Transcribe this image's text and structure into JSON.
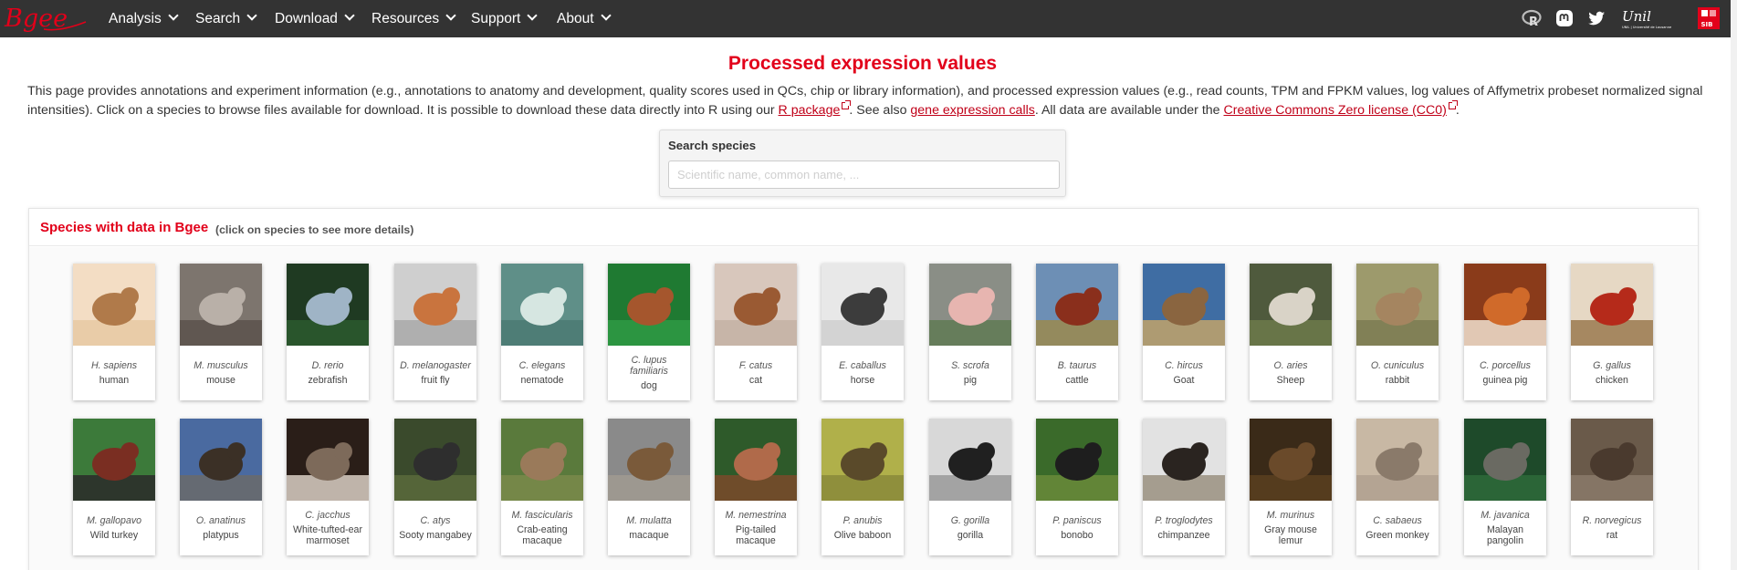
{
  "nav": {
    "logo_text": "Bgee",
    "items": [
      {
        "label": "Analysis"
      },
      {
        "label": "Search"
      },
      {
        "label": "Download"
      },
      {
        "label": "Resources"
      },
      {
        "label": "Support"
      },
      {
        "label": "About"
      }
    ],
    "icons": [
      "r-package-icon",
      "mastodon-icon",
      "twitter-icon",
      "unil-logo",
      "sib-logo"
    ],
    "unil_text": "Unil",
    "unil_subtext": "UNIL | Université de Lausanne",
    "sib_text": "SIB"
  },
  "page": {
    "title": "Processed expression values",
    "intro": {
      "t1": "This page provides annotations and experiment information (e.g., annotations to anatomy and development, quality scores used in QCs, chip or library information), and processed expression values (e.g., read counts, TPM and FPKM values, log values of Affymetrix probeset normalized signal intensities). Click on a species to browse files available for download. It is possible to download these data directly into R using our ",
      "link1": "R package",
      "t2": ". See also ",
      "link2": "gene expression calls",
      "t3": ". All data are available under the ",
      "link3": "Creative Commons Zero license (CC0)",
      "t4": "."
    }
  },
  "search": {
    "label": "Search species",
    "placeholder": "Scientific name, common name, ...",
    "value": ""
  },
  "species_panel": {
    "title": "Species with data in Bgee",
    "note": "(click on species to see more details)"
  },
  "colors": {
    "brand_red": "#e2001a",
    "navbar": "#333333",
    "link": "#c00018"
  },
  "species": [
    {
      "sci": "H. sapiens",
      "common": "human"
    },
    {
      "sci": "M. musculus",
      "common": "mouse"
    },
    {
      "sci": "D. rerio",
      "common": "zebrafish"
    },
    {
      "sci": "D. melanogaster",
      "common": "fruit fly"
    },
    {
      "sci": "C. elegans",
      "common": "nematode"
    },
    {
      "sci": "C. lupus familiaris",
      "common": "dog"
    },
    {
      "sci": "F. catus",
      "common": "cat"
    },
    {
      "sci": "E. caballus",
      "common": "horse"
    },
    {
      "sci": "S. scrofa",
      "common": "pig"
    },
    {
      "sci": "B. taurus",
      "common": "cattle"
    },
    {
      "sci": "C. hircus",
      "common": "Goat"
    },
    {
      "sci": "O. aries",
      "common": "Sheep"
    },
    {
      "sci": "O. cuniculus",
      "common": "rabbit"
    },
    {
      "sci": "C. porcellus",
      "common": "guinea pig"
    },
    {
      "sci": "G. gallus",
      "common": "chicken"
    },
    {
      "sci": "M. gallopavo",
      "common": "Wild turkey"
    },
    {
      "sci": "O. anatinus",
      "common": "platypus"
    },
    {
      "sci": "C. jacchus",
      "common": "White-tufted-ear marmoset"
    },
    {
      "sci": "C. atys",
      "common": "Sooty mangabey"
    },
    {
      "sci": "M. fascicularis",
      "common": "Crab-eating macaque"
    },
    {
      "sci": "M. mulatta",
      "common": "macaque"
    },
    {
      "sci": "M. nemestrina",
      "common": "Pig-tailed macaque"
    },
    {
      "sci": "P. anubis",
      "common": "Olive baboon"
    },
    {
      "sci": "G. gorilla",
      "common": "gorilla"
    },
    {
      "sci": "P. paniscus",
      "common": "bonobo"
    },
    {
      "sci": "P. troglodytes",
      "common": "chimpanzee"
    },
    {
      "sci": "M. murinus",
      "common": "Gray mouse lemur"
    },
    {
      "sci": "C. sabaeus",
      "common": "Green monkey"
    },
    {
      "sci": "M. javanica",
      "common": "Malayan pangolin"
    },
    {
      "sci": "R. norvegicus",
      "common": "rat"
    }
  ]
}
